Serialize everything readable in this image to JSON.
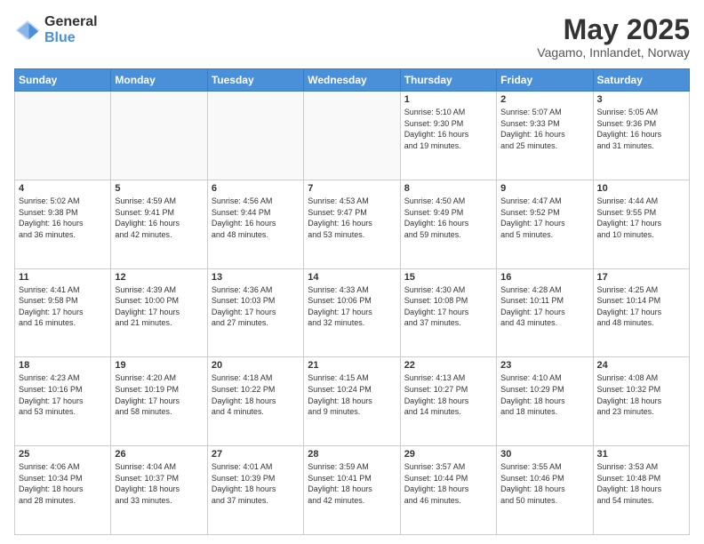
{
  "logo": {
    "general": "General",
    "blue": "Blue"
  },
  "title": "May 2025",
  "subtitle": "Vagamo, Innlandet, Norway",
  "weekdays": [
    "Sunday",
    "Monday",
    "Tuesday",
    "Wednesday",
    "Thursday",
    "Friday",
    "Saturday"
  ],
  "weeks": [
    [
      {
        "day": "",
        "info": ""
      },
      {
        "day": "",
        "info": ""
      },
      {
        "day": "",
        "info": ""
      },
      {
        "day": "",
        "info": ""
      },
      {
        "day": "1",
        "info": "Sunrise: 5:10 AM\nSunset: 9:30 PM\nDaylight: 16 hours\nand 19 minutes."
      },
      {
        "day": "2",
        "info": "Sunrise: 5:07 AM\nSunset: 9:33 PM\nDaylight: 16 hours\nand 25 minutes."
      },
      {
        "day": "3",
        "info": "Sunrise: 5:05 AM\nSunset: 9:36 PM\nDaylight: 16 hours\nand 31 minutes."
      }
    ],
    [
      {
        "day": "4",
        "info": "Sunrise: 5:02 AM\nSunset: 9:38 PM\nDaylight: 16 hours\nand 36 minutes."
      },
      {
        "day": "5",
        "info": "Sunrise: 4:59 AM\nSunset: 9:41 PM\nDaylight: 16 hours\nand 42 minutes."
      },
      {
        "day": "6",
        "info": "Sunrise: 4:56 AM\nSunset: 9:44 PM\nDaylight: 16 hours\nand 48 minutes."
      },
      {
        "day": "7",
        "info": "Sunrise: 4:53 AM\nSunset: 9:47 PM\nDaylight: 16 hours\nand 53 minutes."
      },
      {
        "day": "8",
        "info": "Sunrise: 4:50 AM\nSunset: 9:49 PM\nDaylight: 16 hours\nand 59 minutes."
      },
      {
        "day": "9",
        "info": "Sunrise: 4:47 AM\nSunset: 9:52 PM\nDaylight: 17 hours\nand 5 minutes."
      },
      {
        "day": "10",
        "info": "Sunrise: 4:44 AM\nSunset: 9:55 PM\nDaylight: 17 hours\nand 10 minutes."
      }
    ],
    [
      {
        "day": "11",
        "info": "Sunrise: 4:41 AM\nSunset: 9:58 PM\nDaylight: 17 hours\nand 16 minutes."
      },
      {
        "day": "12",
        "info": "Sunrise: 4:39 AM\nSunset: 10:00 PM\nDaylight: 17 hours\nand 21 minutes."
      },
      {
        "day": "13",
        "info": "Sunrise: 4:36 AM\nSunset: 10:03 PM\nDaylight: 17 hours\nand 27 minutes."
      },
      {
        "day": "14",
        "info": "Sunrise: 4:33 AM\nSunset: 10:06 PM\nDaylight: 17 hours\nand 32 minutes."
      },
      {
        "day": "15",
        "info": "Sunrise: 4:30 AM\nSunset: 10:08 PM\nDaylight: 17 hours\nand 37 minutes."
      },
      {
        "day": "16",
        "info": "Sunrise: 4:28 AM\nSunset: 10:11 PM\nDaylight: 17 hours\nand 43 minutes."
      },
      {
        "day": "17",
        "info": "Sunrise: 4:25 AM\nSunset: 10:14 PM\nDaylight: 17 hours\nand 48 minutes."
      }
    ],
    [
      {
        "day": "18",
        "info": "Sunrise: 4:23 AM\nSunset: 10:16 PM\nDaylight: 17 hours\nand 53 minutes."
      },
      {
        "day": "19",
        "info": "Sunrise: 4:20 AM\nSunset: 10:19 PM\nDaylight: 17 hours\nand 58 minutes."
      },
      {
        "day": "20",
        "info": "Sunrise: 4:18 AM\nSunset: 10:22 PM\nDaylight: 18 hours\nand 4 minutes."
      },
      {
        "day": "21",
        "info": "Sunrise: 4:15 AM\nSunset: 10:24 PM\nDaylight: 18 hours\nand 9 minutes."
      },
      {
        "day": "22",
        "info": "Sunrise: 4:13 AM\nSunset: 10:27 PM\nDaylight: 18 hours\nand 14 minutes."
      },
      {
        "day": "23",
        "info": "Sunrise: 4:10 AM\nSunset: 10:29 PM\nDaylight: 18 hours\nand 18 minutes."
      },
      {
        "day": "24",
        "info": "Sunrise: 4:08 AM\nSunset: 10:32 PM\nDaylight: 18 hours\nand 23 minutes."
      }
    ],
    [
      {
        "day": "25",
        "info": "Sunrise: 4:06 AM\nSunset: 10:34 PM\nDaylight: 18 hours\nand 28 minutes."
      },
      {
        "day": "26",
        "info": "Sunrise: 4:04 AM\nSunset: 10:37 PM\nDaylight: 18 hours\nand 33 minutes."
      },
      {
        "day": "27",
        "info": "Sunrise: 4:01 AM\nSunset: 10:39 PM\nDaylight: 18 hours\nand 37 minutes."
      },
      {
        "day": "28",
        "info": "Sunrise: 3:59 AM\nSunset: 10:41 PM\nDaylight: 18 hours\nand 42 minutes."
      },
      {
        "day": "29",
        "info": "Sunrise: 3:57 AM\nSunset: 10:44 PM\nDaylight: 18 hours\nand 46 minutes."
      },
      {
        "day": "30",
        "info": "Sunrise: 3:55 AM\nSunset: 10:46 PM\nDaylight: 18 hours\nand 50 minutes."
      },
      {
        "day": "31",
        "info": "Sunrise: 3:53 AM\nSunset: 10:48 PM\nDaylight: 18 hours\nand 54 minutes."
      }
    ]
  ]
}
